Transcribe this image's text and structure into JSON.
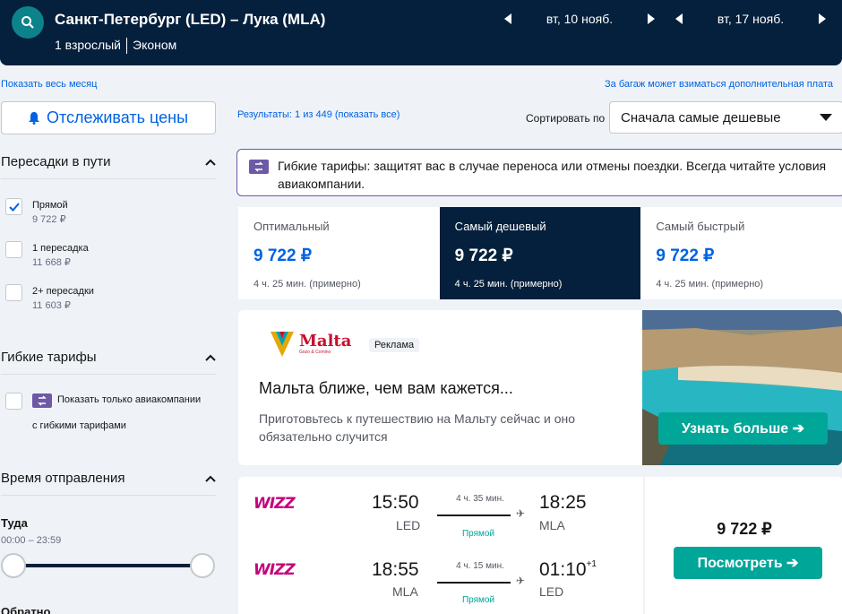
{
  "header": {
    "route": "Санкт-Петербург (LED) – Лука (MLA)",
    "passengers": "1 взрослый",
    "cabin": "Эконом",
    "date_out": "вт, 10 нояб.",
    "date_back": "вт, 17 нояб."
  },
  "links": {
    "whole_month": "Показать весь месяц",
    "baggage_note": "За багаж может взиматься дополнительная плата"
  },
  "track_prices": "Отслеживать цены",
  "filters": {
    "stops": {
      "title": "Пересадки в пути",
      "options": [
        {
          "label": "Прямой",
          "price": "9 722 ₽",
          "checked": true
        },
        {
          "label": "1 пересадка",
          "price": "11 668 ₽",
          "checked": false
        },
        {
          "label": "2+ пересадки",
          "price": "11 603 ₽",
          "checked": false
        }
      ]
    },
    "flexible": {
      "title": "Гибкие тарифы",
      "label_line1": "Показать только авиакомпании",
      "label_line2": "с гибкими тарифами"
    },
    "departure": {
      "title": "Время отправления",
      "out_label": "Туда",
      "out_range": "00:00 – 23:59",
      "back_label": "Обратно"
    }
  },
  "results": {
    "count_text": "Результаты: 1 из 449 (показать все)",
    "sort_label": "Сортировать по",
    "sort_value": "Сначала самые дешевые"
  },
  "flex_banner": {
    "text": "Гибкие тарифы: защитят вас в случае переноса или отмены поездки. Всегда читайте условия авиакомпании."
  },
  "tabs": [
    {
      "name": "Оптимальный",
      "price": "9 722 ₽",
      "duration": "4 ч. 25 мин. (примерно)",
      "active": false
    },
    {
      "name": "Самый дешевый",
      "price": "9 722 ₽",
      "duration": "4 ч. 25 мин. (примерно)",
      "active": true
    },
    {
      "name": "Самый быстрый",
      "price": "9 722 ₽",
      "duration": "4 ч. 25 мин. (примерно)",
      "active": false
    }
  ],
  "ad": {
    "logo_text": "Malta",
    "logo_sub": "Gozo & Comino",
    "badge": "Реклама",
    "title": "Мальта ближе, чем вам кажется...",
    "text": "Приготовьтесь к путешествию на Мальту сейчас и оно обязательно случится",
    "button": "Узнать больше ➔"
  },
  "flight": {
    "airline": "WIZZ",
    "outbound": {
      "dep_time": "15:50",
      "dep_code": "LED",
      "duration": "4 ч. 35 мин.",
      "stops": "Прямой",
      "arr_time": "18:25",
      "arr_code": "MLA"
    },
    "inbound": {
      "dep_time": "18:55",
      "dep_code": "MLA",
      "duration": "4 ч. 15 мин.",
      "stops": "Прямой",
      "arr_time": "01:10",
      "arr_plus": "+1",
      "arr_code": "LED"
    },
    "price": "9 722 ₽",
    "button": "Посмотреть ➔"
  },
  "colors": {
    "header_bg": "#05203c",
    "accent_blue": "#0062e3",
    "cta_green": "#00a698",
    "flex_purple": "#6d59a6"
  }
}
